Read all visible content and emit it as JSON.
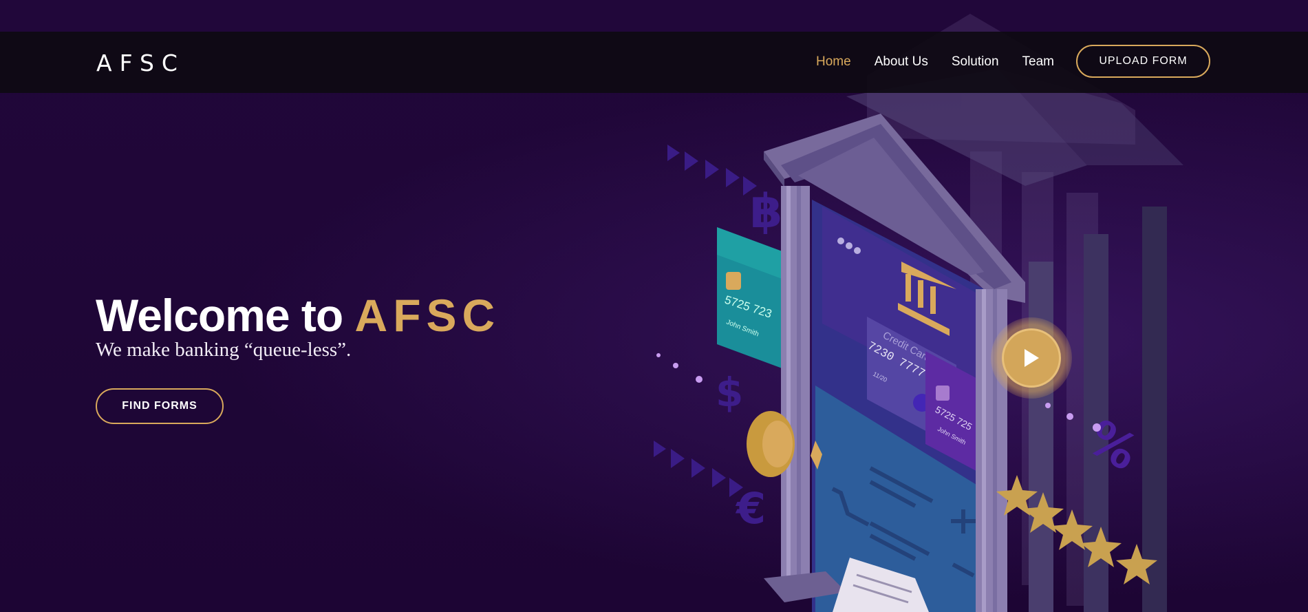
{
  "brand": {
    "logo": "AFSC"
  },
  "nav": {
    "items": [
      {
        "label": "Home",
        "active": true
      },
      {
        "label": "About Us",
        "active": false
      },
      {
        "label": "Solution",
        "active": false
      },
      {
        "label": "Team",
        "active": false
      }
    ],
    "upload_label": "UPLOAD FORM"
  },
  "hero": {
    "title_prefix": "Welcome to ",
    "title_brand": "AFSC",
    "subtitle": "We make banking “queue-less”.",
    "cta_label": "FIND FORMS"
  },
  "illustration": {
    "card_main_label": "Credit Card",
    "card_number": "7230 7777 0000",
    "card_expiry": "11/20",
    "card_small_number": "5725 723",
    "card_small_holder": "John Smith",
    "card_right_number": "5725 725",
    "card_right_holder": "John Smith"
  },
  "colors": {
    "background": "#1f0638",
    "accent_gold": "#d9a95c",
    "navbar": "#0e0a12"
  },
  "icons": [
    "bank-icon",
    "bitcoin-icon",
    "dollar-icon",
    "euro-icon",
    "percent-icon",
    "star-icon",
    "cart-icon",
    "play-icon"
  ]
}
